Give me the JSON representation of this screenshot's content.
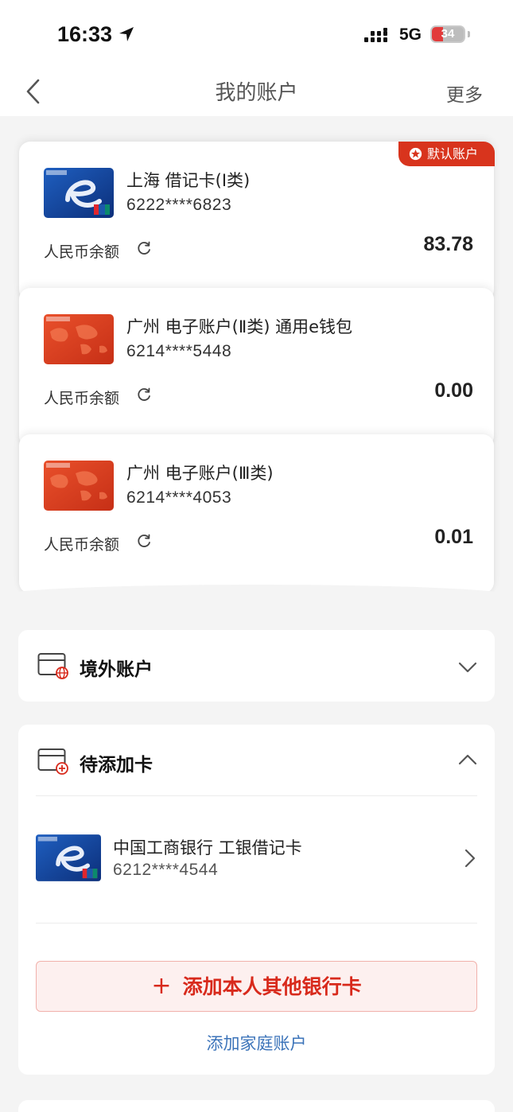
{
  "status": {
    "time": "16:33",
    "network": "5G",
    "battery": "34",
    "battery_level_percent": 34,
    "icons": [
      "location-arrow-icon",
      "signal-icon",
      "battery-icon"
    ]
  },
  "nav": {
    "title": "我的账户",
    "more": "更多",
    "back_icon": "chevron-left-icon"
  },
  "accounts": [
    {
      "name": "上海 借记卡(Ⅰ类)",
      "number": "6222****6823",
      "balance_label": "人民币余额",
      "balance": "83.78",
      "card_style": "icbc-e-blue",
      "badge": "默认账户"
    },
    {
      "name": "广州 电子账户(Ⅱ类) 通用e钱包",
      "number": "6214****5448",
      "balance_label": "人民币余额",
      "balance": "0.00",
      "card_style": "icbc-red-map"
    },
    {
      "name": "广州 电子账户(Ⅲ类)",
      "number": "6214****4053",
      "balance_label": "人民币余额",
      "balance": "0.01",
      "card_style": "icbc-red-map"
    }
  ],
  "overseas": {
    "title": "境外账户",
    "icon": "globe-card-icon",
    "state": "collapsed"
  },
  "pending": {
    "title": "待添加卡",
    "icon": "add-card-icon",
    "state": "expanded",
    "cards": [
      {
        "name": "中国工商银行 工银借记卡",
        "number": "6212****4544",
        "card_style": "icbc-e-blue"
      }
    ],
    "add_button": "添加本人其他银行卡",
    "family_link": "添加家庭账户"
  },
  "colors": {
    "accent_red": "#d82a1c",
    "badge_red": "#d8341d",
    "link_blue": "#3b73b9",
    "background": "#f4f4f4"
  }
}
